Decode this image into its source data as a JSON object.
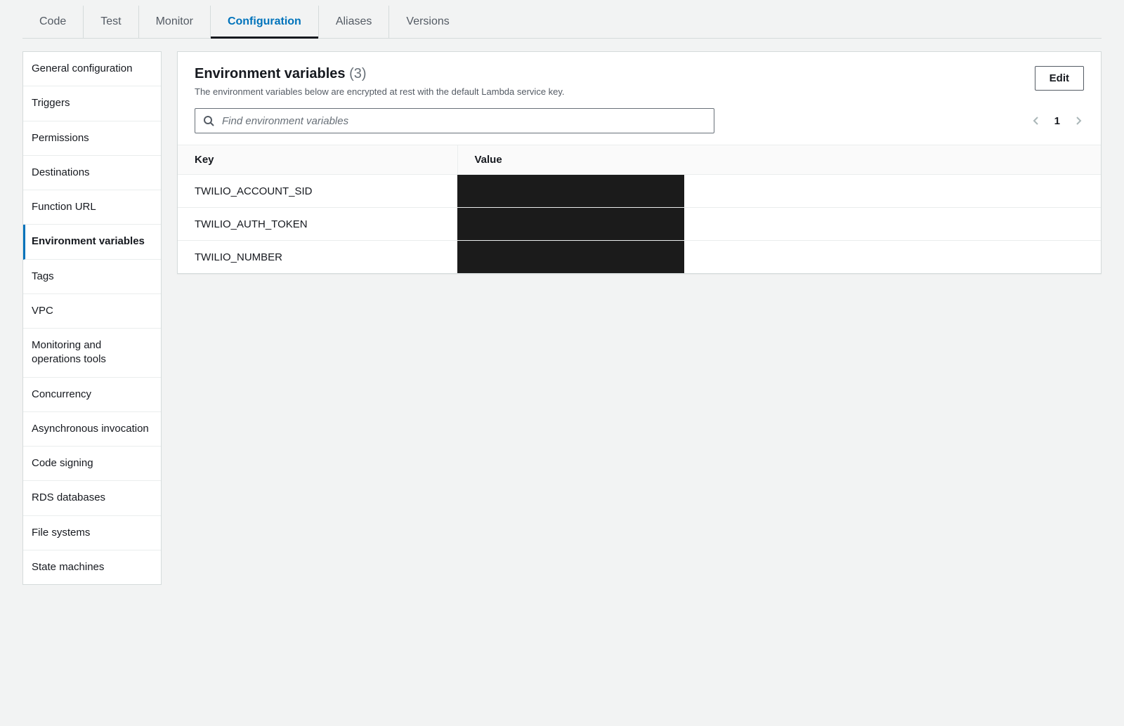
{
  "tabs": [
    {
      "label": "Code",
      "active": false
    },
    {
      "label": "Test",
      "active": false
    },
    {
      "label": "Monitor",
      "active": false
    },
    {
      "label": "Configuration",
      "active": true
    },
    {
      "label": "Aliases",
      "active": false
    },
    {
      "label": "Versions",
      "active": false
    }
  ],
  "sidebar": {
    "items": [
      {
        "label": "General configuration",
        "active": false
      },
      {
        "label": "Triggers",
        "active": false
      },
      {
        "label": "Permissions",
        "active": false
      },
      {
        "label": "Destinations",
        "active": false
      },
      {
        "label": "Function URL",
        "active": false
      },
      {
        "label": "Environment variables",
        "active": true
      },
      {
        "label": "Tags",
        "active": false
      },
      {
        "label": "VPC",
        "active": false
      },
      {
        "label": "Monitoring and operations tools",
        "active": false
      },
      {
        "label": "Concurrency",
        "active": false
      },
      {
        "label": "Asynchronous invocation",
        "active": false
      },
      {
        "label": "Code signing",
        "active": false
      },
      {
        "label": "RDS databases",
        "active": false
      },
      {
        "label": "File systems",
        "active": false
      },
      {
        "label": "State machines",
        "active": false
      }
    ]
  },
  "panel": {
    "title": "Environment variables",
    "count": "(3)",
    "subtitle": "The environment variables below are encrypted at rest with the default Lambda service key.",
    "edit_label": "Edit",
    "search_placeholder": "Find environment variables",
    "page": "1",
    "columns": {
      "key": "Key",
      "value": "Value"
    },
    "rows": [
      {
        "key": "TWILIO_ACCOUNT_SID",
        "value_redacted": true
      },
      {
        "key": "TWILIO_AUTH_TOKEN",
        "value_redacted": true
      },
      {
        "key": "TWILIO_NUMBER",
        "value_redacted": true
      }
    ]
  }
}
